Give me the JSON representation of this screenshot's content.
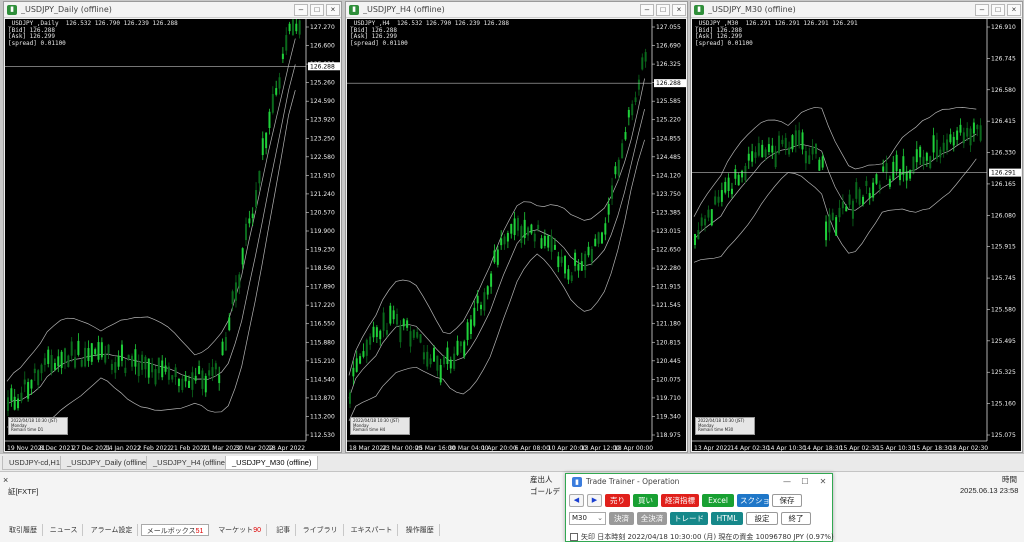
{
  "windows": [
    {
      "title": "_USDJPY_Daily (offline)",
      "info": [
        "_USDJPY_,Daily  126.532 126.790 126.239 126.288",
        "[Bid] 126.288",
        "[Ask] 126.299",
        "[spread] 0.01100"
      ],
      "price_label": "126.288",
      "y_ticks": [
        "127.270",
        "126.600",
        "125.930",
        "125.260",
        "124.590",
        "123.920",
        "123.250",
        "122.580",
        "121.910",
        "121.240",
        "120.570",
        "119.900",
        "119.230",
        "118.560",
        "117.890",
        "117.220",
        "116.550",
        "115.880",
        "115.210",
        "114.540",
        "113.870",
        "113.200",
        "112.530"
      ],
      "x_ticks": [
        "19 Nov 2021",
        "8 Dec 2021",
        "27 Dec 2021",
        "14 Jan 2022",
        "2 Feb 2022",
        "21 Feb 2022",
        "11 Mar 2022",
        "30 Mar 2022",
        "18 Apr 2022"
      ],
      "mini": [
        "2022/04/18 10:30 (JST)",
        "Monday",
        "Remain time   D1"
      ]
    },
    {
      "title": "_USDJPY_H4 (offline)",
      "info": [
        "_USDJPY_,H4  126.532 126.790 126.239 126.288",
        "[Bid] 126.288",
        "[Ask] 126.299",
        "[spread] 0.01100"
      ],
      "price_label": "126.288",
      "y_ticks": [
        "127.055",
        "126.690",
        "126.325",
        "125.955",
        "125.585",
        "125.220",
        "124.855",
        "124.485",
        "124.120",
        "123.750",
        "123.385",
        "123.015",
        "122.650",
        "122.280",
        "121.915",
        "121.545",
        "121.180",
        "120.815",
        "120.445",
        "120.075",
        "119.710",
        "119.340",
        "118.975"
      ],
      "x_ticks": [
        "18 Mar 2022",
        "23 Mar 00:00",
        "25 Mar 16:00",
        "30 Mar 04:00",
        "1 Apr 20:00",
        "6 Apr 08:00",
        "10 Apr 20:00",
        "13 Apr 12:00",
        "18 Apr 00:00"
      ],
      "mini": [
        "2022/04/18 10:30 (JST)",
        "Monday",
        "Remain time   H4"
      ]
    },
    {
      "title": "_USDJPY_M30 (offline)",
      "info": [
        "_USDJPY_,M30  126.291 126.291 126.291 126.291",
        "[Bid] 126.288",
        "[Ask] 126.299",
        "[spread] 0.01100"
      ],
      "price_label": "126.291",
      "y_ticks": [
        "126.910",
        "126.745",
        "126.580",
        "126.415",
        "126.330",
        "126.165",
        "126.080",
        "125.915",
        "125.745",
        "125.580",
        "125.495",
        "125.325",
        "125.160",
        "125.075"
      ],
      "x_ticks": [
        "13 Apr 2022",
        "14 Apr 02:30",
        "14 Apr 10:30",
        "14 Apr 18:30",
        "15 Apr 02:30",
        "15 Apr 10:30",
        "15 Apr 18:30",
        "18 Apr 02:30"
      ],
      "mini": [
        "2022/04/18 10:30 (JST)",
        "Monday",
        "Remain time   M30"
      ]
    }
  ],
  "chart_tabs": [
    "USDJPY-cd,H1",
    "_USDJPY_Daily (offline)",
    "_USDJPY_H4 (offline)",
    "_USDJPY_M30 (offline)"
  ],
  "active_chart_tab": 3,
  "bottom": {
    "close_mark": "×",
    "broker": "証[FXTF]",
    "label1": "産出人",
    "label2": "ゴールデ",
    "time_header": "時間",
    "timestamp": "2025.06.13 23:58"
  },
  "terminal_tabs": [
    {
      "label": "取引履歴",
      "badge": ""
    },
    {
      "label": "ニュース",
      "badge": ""
    },
    {
      "label": "アラーム設定",
      "badge": ""
    },
    {
      "label": "メールボックス",
      "badge": "51"
    },
    {
      "label": "マーケット",
      "badge": "90"
    },
    {
      "label": "記事",
      "badge": ""
    },
    {
      "label": "ライブラリ",
      "badge": ""
    },
    {
      "label": "エキスパート",
      "badge": ""
    },
    {
      "label": "操作履歴",
      "badge": ""
    }
  ],
  "active_terminal_tab": 3,
  "trade_trainer": {
    "title": "Trade Trainer - Operation",
    "controls": [
      "—",
      "☐",
      "✕"
    ],
    "prev": "◀",
    "next": "▶",
    "row1": [
      "売り",
      "買い",
      "経済指標",
      "Excel",
      "スクショ",
      "保存"
    ],
    "timeframe": "M30",
    "row2": [
      "決済",
      "全決済",
      "トレード",
      "HTML",
      "設定",
      "終了"
    ],
    "status": "矢印   日本時刻 2022/04/18 10:30:00 (月)    現在の資金 10096780 JPY (0.97%)"
  },
  "colors": {
    "bull": "#1fd13a",
    "bear": "#0a6a1c",
    "band": "#b4b4b4",
    "chart_bg": "#000000"
  }
}
